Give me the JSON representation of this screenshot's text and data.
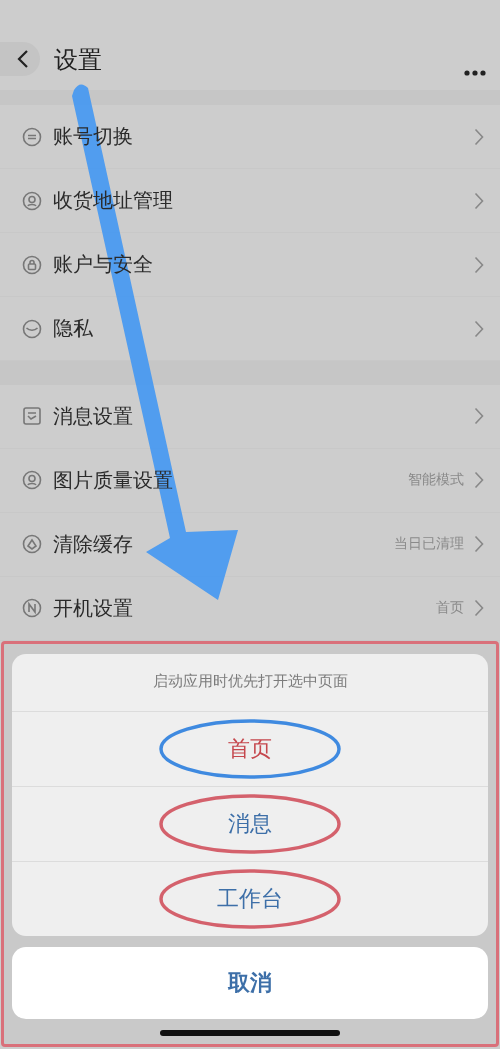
{
  "header": {
    "title": "设置"
  },
  "sections": [
    {
      "items": [
        {
          "label": "账号切换"
        },
        {
          "label": "收货地址管理"
        },
        {
          "label": "账户与安全"
        },
        {
          "label": "隐私"
        }
      ]
    },
    {
      "items": [
        {
          "label": "消息设置"
        },
        {
          "label": "图片质量设置",
          "value": "智能模式"
        },
        {
          "label": "清除缓存",
          "value": "当日已清理"
        },
        {
          "label": "开机设置",
          "value": "首页"
        }
      ]
    }
  ],
  "sheet": {
    "prompt": "启动应用时优先打开选中页面",
    "options": [
      {
        "label": "首页",
        "selected": true
      },
      {
        "label": "消息",
        "selected": false
      },
      {
        "label": "工作台",
        "selected": false
      }
    ],
    "cancel": "取消"
  }
}
